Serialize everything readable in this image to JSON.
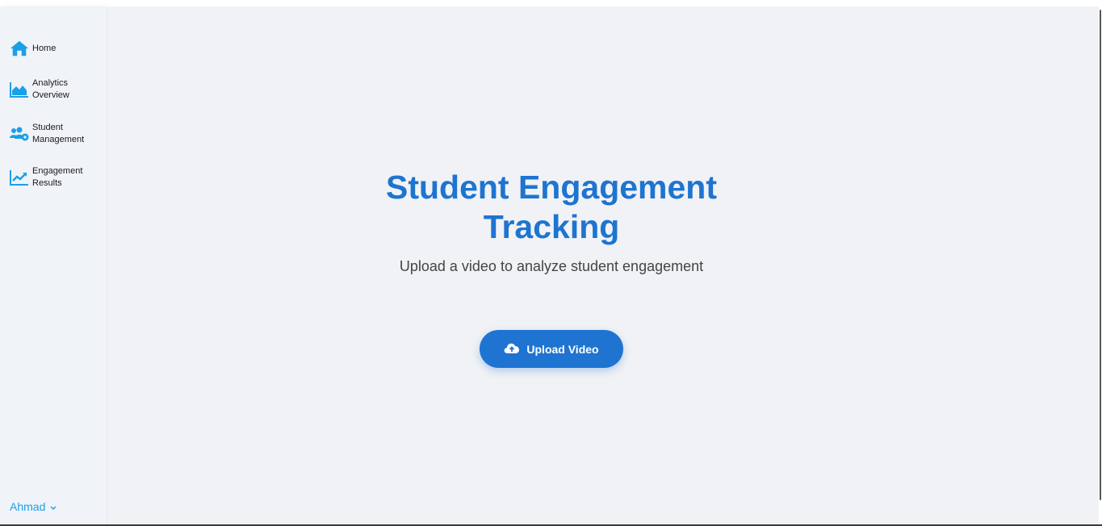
{
  "sidebar": {
    "items": [
      {
        "label": "Home",
        "icon": "home-icon"
      },
      {
        "label": "Analytics\nOverview",
        "icon": "area-chart-icon"
      },
      {
        "label": "Student\nManagement",
        "icon": "users-gear-icon"
      },
      {
        "label": "Engagement\nResults",
        "icon": "line-chart-icon"
      }
    ],
    "user": {
      "name": "Ahmad",
      "icon": "chevron-down-icon"
    }
  },
  "main": {
    "title": "Student Engagement\nTracking",
    "subtitle": "Upload a video to analyze student engagement",
    "upload_button": {
      "label": "Upload Video",
      "icon": "cloud-upload-icon"
    }
  },
  "colors": {
    "accent": "#1e74d0",
    "icon": "#1aa0e6",
    "background": "#f0f2f6"
  }
}
